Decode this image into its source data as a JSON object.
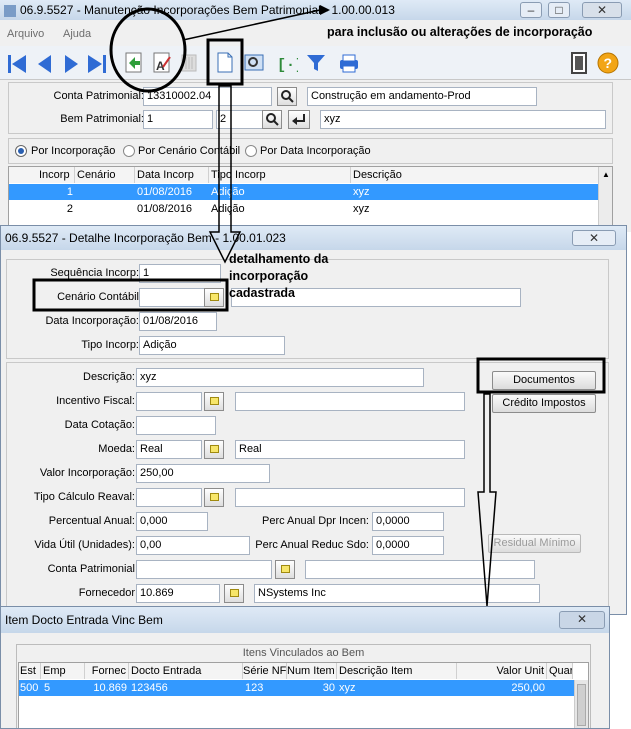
{
  "main": {
    "title": "06.9.5527 - Manutenção Incorporações Bem Patrimonial - 1.00.00.013",
    "menu": [
      "Arquivo",
      "Ajuda"
    ],
    "conta_label": "Conta Patrimonial:",
    "conta_value": "13310002.04",
    "conta_desc": "Construção em andamento-Prod",
    "bem_label": "Bem Patrimonial:",
    "bem_value": "1",
    "bem_value2": "2",
    "bem_desc": "xyz",
    "radio_incorp": "Por Incorporação",
    "radio_cenario": "Por Cenário Contábil",
    "radio_data": "Por Data Incorporação",
    "grid_headers": [
      "Incorp",
      "Cenário",
      "Data Incorp",
      "Tipo Incorp",
      "Descrição"
    ],
    "grid_rows": [
      [
        "1",
        "",
        "01/08/2016",
        "Adição",
        "xyz"
      ],
      [
        "2",
        "",
        "01/08/2016",
        "Adição",
        "xyz"
      ]
    ]
  },
  "detail": {
    "title": "06.9.5527 - Detalhe Incorporação Bem - 1.00.01.023",
    "seq_label": "Sequência Incorp:",
    "seq_value": "1",
    "cenario_label": "Cenário Contábil",
    "data_label": "Data Incorporação:",
    "data_value": "01/08/2016",
    "tipo_label": "Tipo Incorp:",
    "tipo_value": "Adição",
    "descricao_label": "Descrição:",
    "descricao_value": "xyz",
    "incentivo_label": "Incentivo Fiscal:",
    "cotacao_label": "Data Cotação:",
    "moeda_label": "Moeda:",
    "moeda_value": "Real",
    "moeda_desc": "Real",
    "valor_label": "Valor Incorporação:",
    "valor_value": "250,00",
    "calculo_label": "Tipo Cálculo Reaval:",
    "percentual_label": "Percentual Anual:",
    "percentual_value": "0,000",
    "vida_label": "Vida Útil (Unidades):",
    "vida_value": "0,00",
    "conta_label": "Conta Patrimonial",
    "fornecedor_label": "Fornecedor",
    "fornecedor_value": "10.869",
    "fornecedor_desc": "NSystems Inc",
    "dpr_label": "Perc Anual Dpr Incen:",
    "dpr_value": "0,0000",
    "reduc_label": "Perc Anual Reduc Sdo:",
    "reduc_value": "0,0000",
    "documentos_btn": "Documentos",
    "creditos_btn": "Crédito Impostos",
    "residual_btn": "Residual Mínimo"
  },
  "item": {
    "title": "Item Docto Entrada Vinc Bem",
    "group_title": "Itens Vinculados ao Bem",
    "headers": [
      "Est",
      "Emp",
      "Fornec",
      "Docto Entrada",
      "Série NF",
      "Num Item",
      "Descrição Item",
      "Valor Unit",
      "Quar"
    ],
    "rows": [
      [
        "500",
        "5",
        "10.869",
        "123456",
        "123",
        "30",
        "xyz",
        "250,00",
        ""
      ]
    ]
  },
  "annotations": {
    "top": "para inclusão ou alterações de incorporação",
    "detail": "detalhamento da incorporação cadastrada"
  }
}
